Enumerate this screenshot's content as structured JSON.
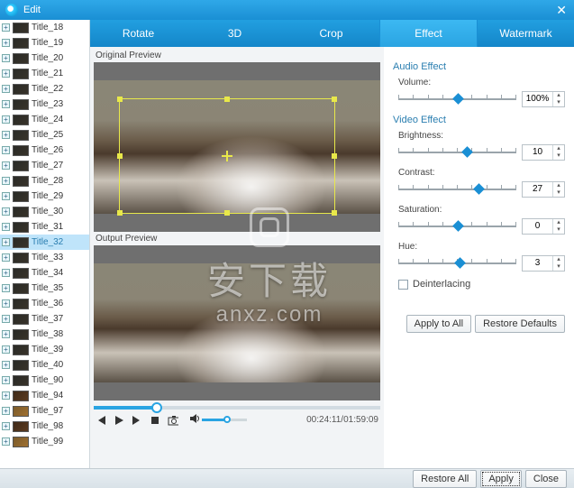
{
  "window": {
    "title": "Edit"
  },
  "tabs": {
    "rotate": "Rotate",
    "threeD": "3D",
    "crop": "Crop",
    "effect": "Effect",
    "watermark": "Watermark",
    "active": "effect"
  },
  "sidebar": {
    "items": [
      {
        "label": "Title_18"
      },
      {
        "label": "Title_19"
      },
      {
        "label": "Title_20"
      },
      {
        "label": "Title_21"
      },
      {
        "label": "Title_22"
      },
      {
        "label": "Title_23"
      },
      {
        "label": "Title_24"
      },
      {
        "label": "Title_25"
      },
      {
        "label": "Title_26"
      },
      {
        "label": "Title_27"
      },
      {
        "label": "Title_28"
      },
      {
        "label": "Title_29"
      },
      {
        "label": "Title_30"
      },
      {
        "label": "Title_31"
      },
      {
        "label": "Title_32",
        "selected": true
      },
      {
        "label": "Title_33"
      },
      {
        "label": "Title_34"
      },
      {
        "label": "Title_35"
      },
      {
        "label": "Title_36"
      },
      {
        "label": "Title_37"
      },
      {
        "label": "Title_38"
      },
      {
        "label": "Title_39"
      },
      {
        "label": "Title_40"
      },
      {
        "label": "Title_90"
      },
      {
        "label": "Title_94"
      },
      {
        "label": "Title_97"
      },
      {
        "label": "Title_98"
      },
      {
        "label": "Title_99"
      }
    ]
  },
  "preview": {
    "original_label": "Original Preview",
    "output_label": "Output Preview"
  },
  "playback": {
    "time": "00:24:11/01:59:09",
    "progress_pct": 22,
    "volume_pct": 55
  },
  "effects": {
    "audio_header": "Audio Effect",
    "video_header": "Video Effect",
    "volume": {
      "label": "Volume:",
      "value": "100%",
      "pos_pct": 50
    },
    "brightness": {
      "label": "Brightness:",
      "value": "10",
      "pos_pct": 58
    },
    "contrast": {
      "label": "Contrast:",
      "value": "27",
      "pos_pct": 68
    },
    "saturation": {
      "label": "Saturation:",
      "value": "0",
      "pos_pct": 50
    },
    "hue": {
      "label": "Hue:",
      "value": "3",
      "pos_pct": 52
    },
    "deinterlacing": {
      "label": "Deinterlacing",
      "checked": false
    }
  },
  "buttons": {
    "apply_all": "Apply to All",
    "restore_defaults": "Restore Defaults",
    "restore_all": "Restore All",
    "apply": "Apply",
    "close": "Close"
  },
  "watermark_overlay": {
    "cn": "安下载",
    "en": "anxz.com"
  }
}
